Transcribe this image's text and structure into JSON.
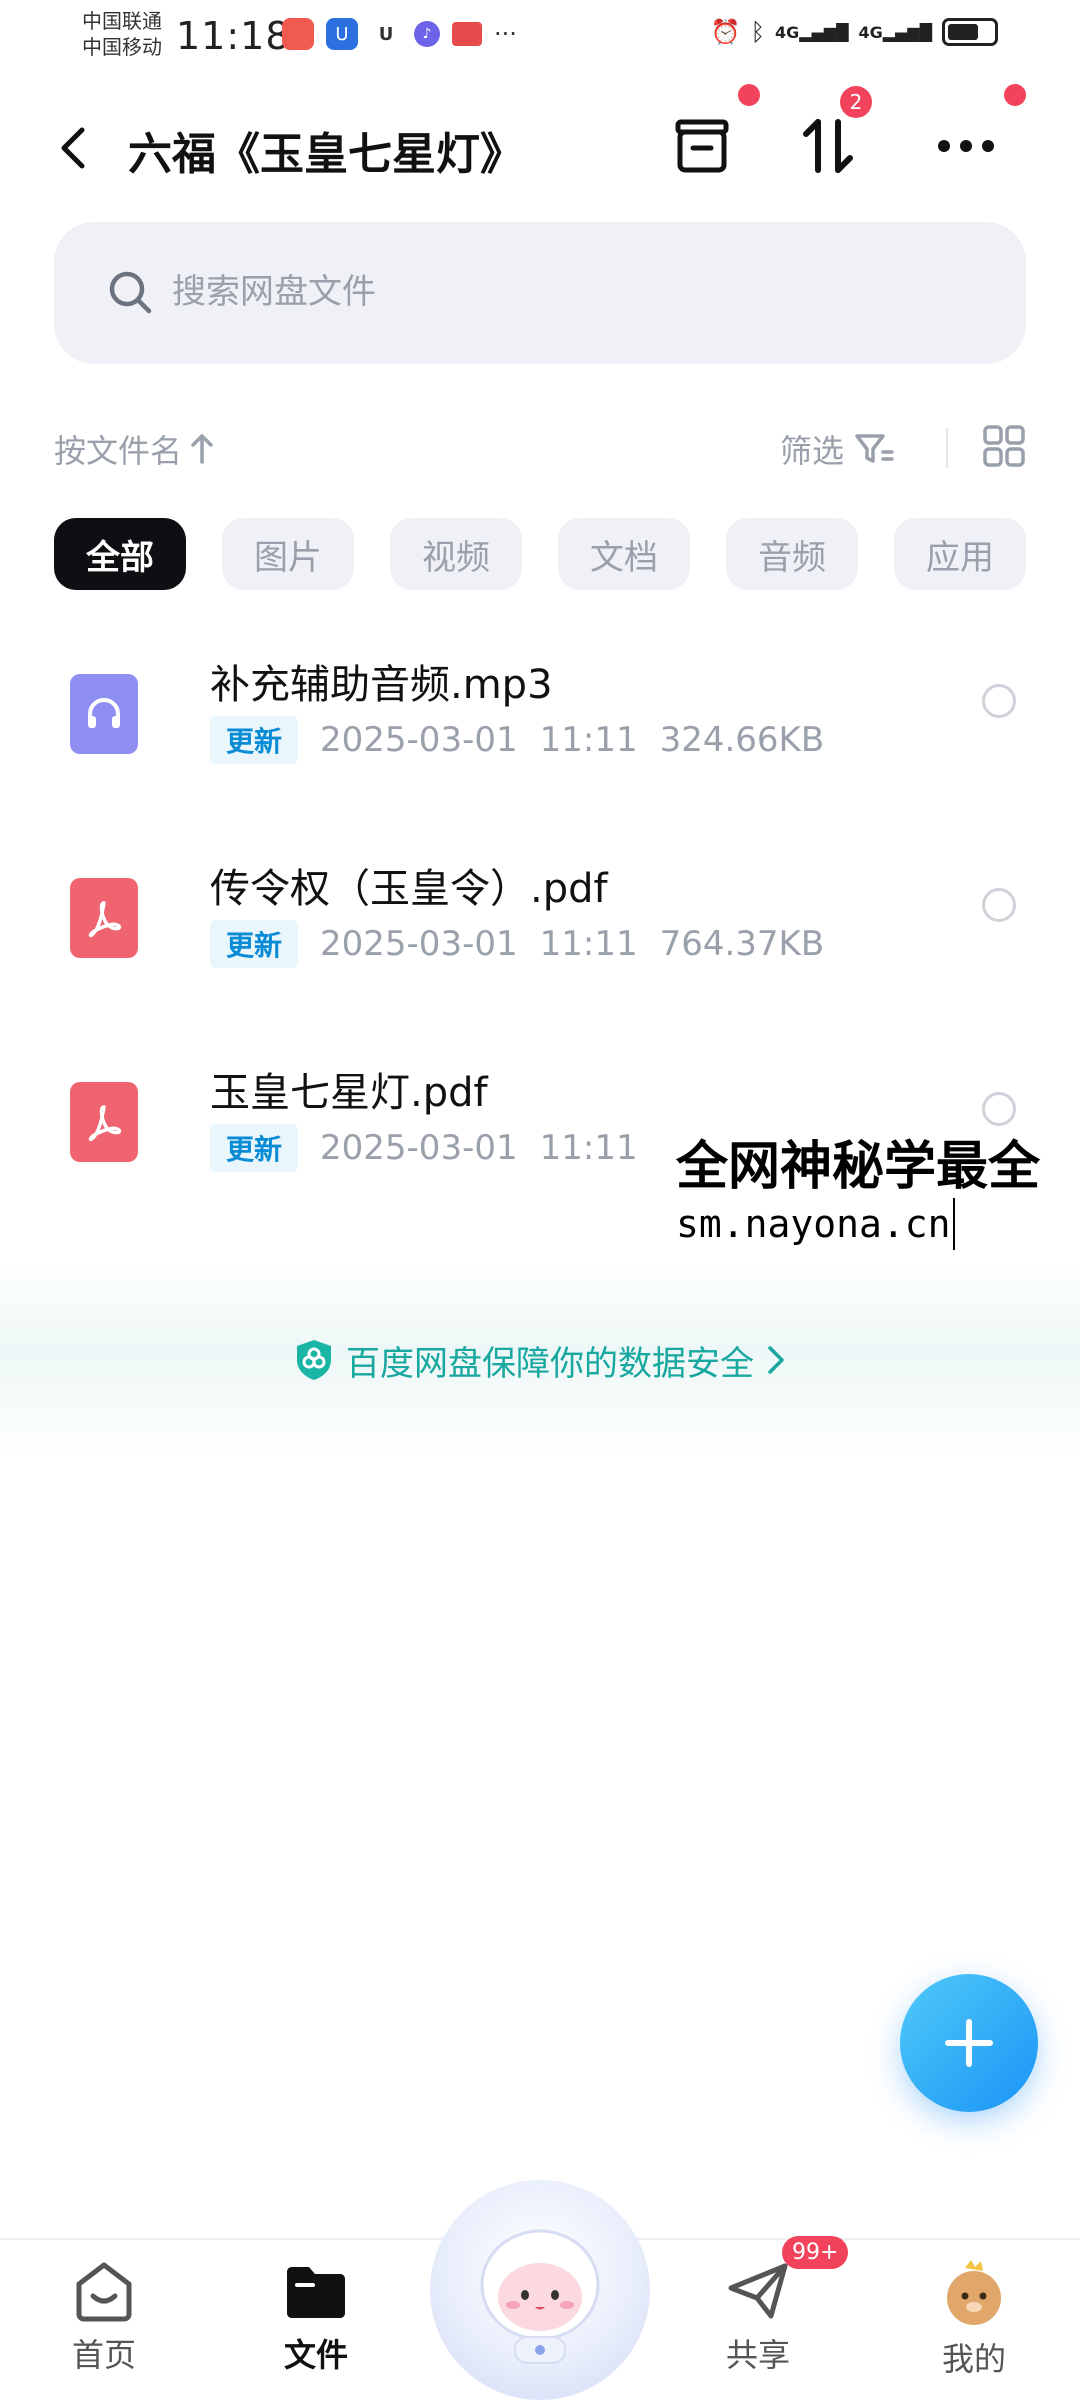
{
  "status_bar": {
    "carrier1": "中国联通",
    "carrier2": "中国移动",
    "time": "11:18",
    "network": "4G"
  },
  "header": {
    "title": "六福《玉皇七星灯》",
    "transfer_badge": "2"
  },
  "search": {
    "placeholder": "搜索网盘文件"
  },
  "sort": {
    "label": "按文件名",
    "filter_label": "筛选"
  },
  "chips": [
    "全部",
    "图片",
    "视频",
    "文档",
    "音频",
    "应用"
  ],
  "files": [
    {
      "name": "补充辅助音频.mp3",
      "tag": "更新",
      "date": "2025-03-01",
      "time": "11:11",
      "size": "324.66KB",
      "icon": "audio-file-icon"
    },
    {
      "name": "传令权（玉皇令）.pdf",
      "tag": "更新",
      "date": "2025-03-01",
      "time": "11:11",
      "size": "764.37KB",
      "icon": "pdf-file-icon"
    },
    {
      "name": "玉皇七星灯.pdf",
      "tag": "更新",
      "date": "2025-03-01",
      "time": "11:11",
      "size": "",
      "icon": "pdf-file-icon"
    }
  ],
  "watermark": {
    "line1": "全网神秘学最全",
    "line2": "sm.nayona.cn"
  },
  "security_banner": {
    "text": "百度网盘保障你的数据安全"
  },
  "bottom_nav": {
    "home": "首页",
    "files": "文件",
    "share": "共享",
    "me": "我的",
    "share_badge": "99+"
  },
  "colors": {
    "accent_blue": "#1a94f5",
    "badge_red": "#f3435c",
    "pdf_red": "#f06470",
    "audio_purple": "#8f8ef3",
    "security_teal": "#18a8a0"
  }
}
